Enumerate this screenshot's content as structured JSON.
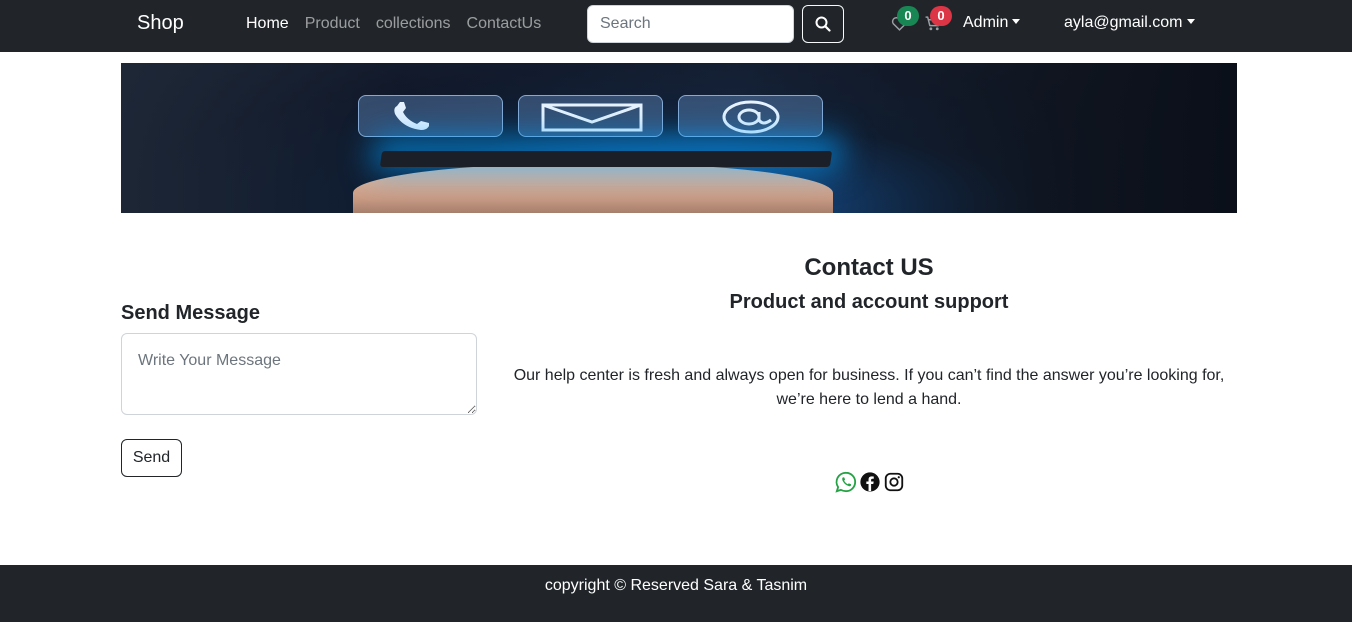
{
  "navbar": {
    "brand": "Shop",
    "links": [
      {
        "label": "Home",
        "active": true
      },
      {
        "label": "Product",
        "active": false
      },
      {
        "label": "collections",
        "active": false
      },
      {
        "label": "ContactUs",
        "active": false
      }
    ],
    "search_placeholder": "Search",
    "search_icon": "search-icon",
    "wishlist": {
      "icon": "heart-icon",
      "count": "0",
      "badge_color": "#198754"
    },
    "cart": {
      "icon": "cart-icon",
      "count": "0",
      "badge_color": "#dc3545"
    },
    "admin_label": "Admin",
    "user_email": "ayla@gmail.com"
  },
  "banner": {
    "icons": [
      "phone-icon",
      "envelope-icon",
      "at-icon"
    ]
  },
  "form": {
    "title": "Send Message",
    "message_placeholder": "Write Your Message",
    "send_label": "Send"
  },
  "contact": {
    "title": "Contact US",
    "subtitle": "Product and account support",
    "description": "Our help center is fresh and always open for business. If you can’t find the answer you’re looking for, we’re here to lend a hand.",
    "socials": [
      "whatsapp-icon",
      "facebook-icon",
      "instagram-icon"
    ]
  },
  "footer": {
    "text": "copyright © Reserved Sara & Tasnim"
  },
  "colors": {
    "navbar": "#212529",
    "whatsapp": "#25a244",
    "badge_green": "#198754",
    "badge_red": "#dc3545"
  }
}
